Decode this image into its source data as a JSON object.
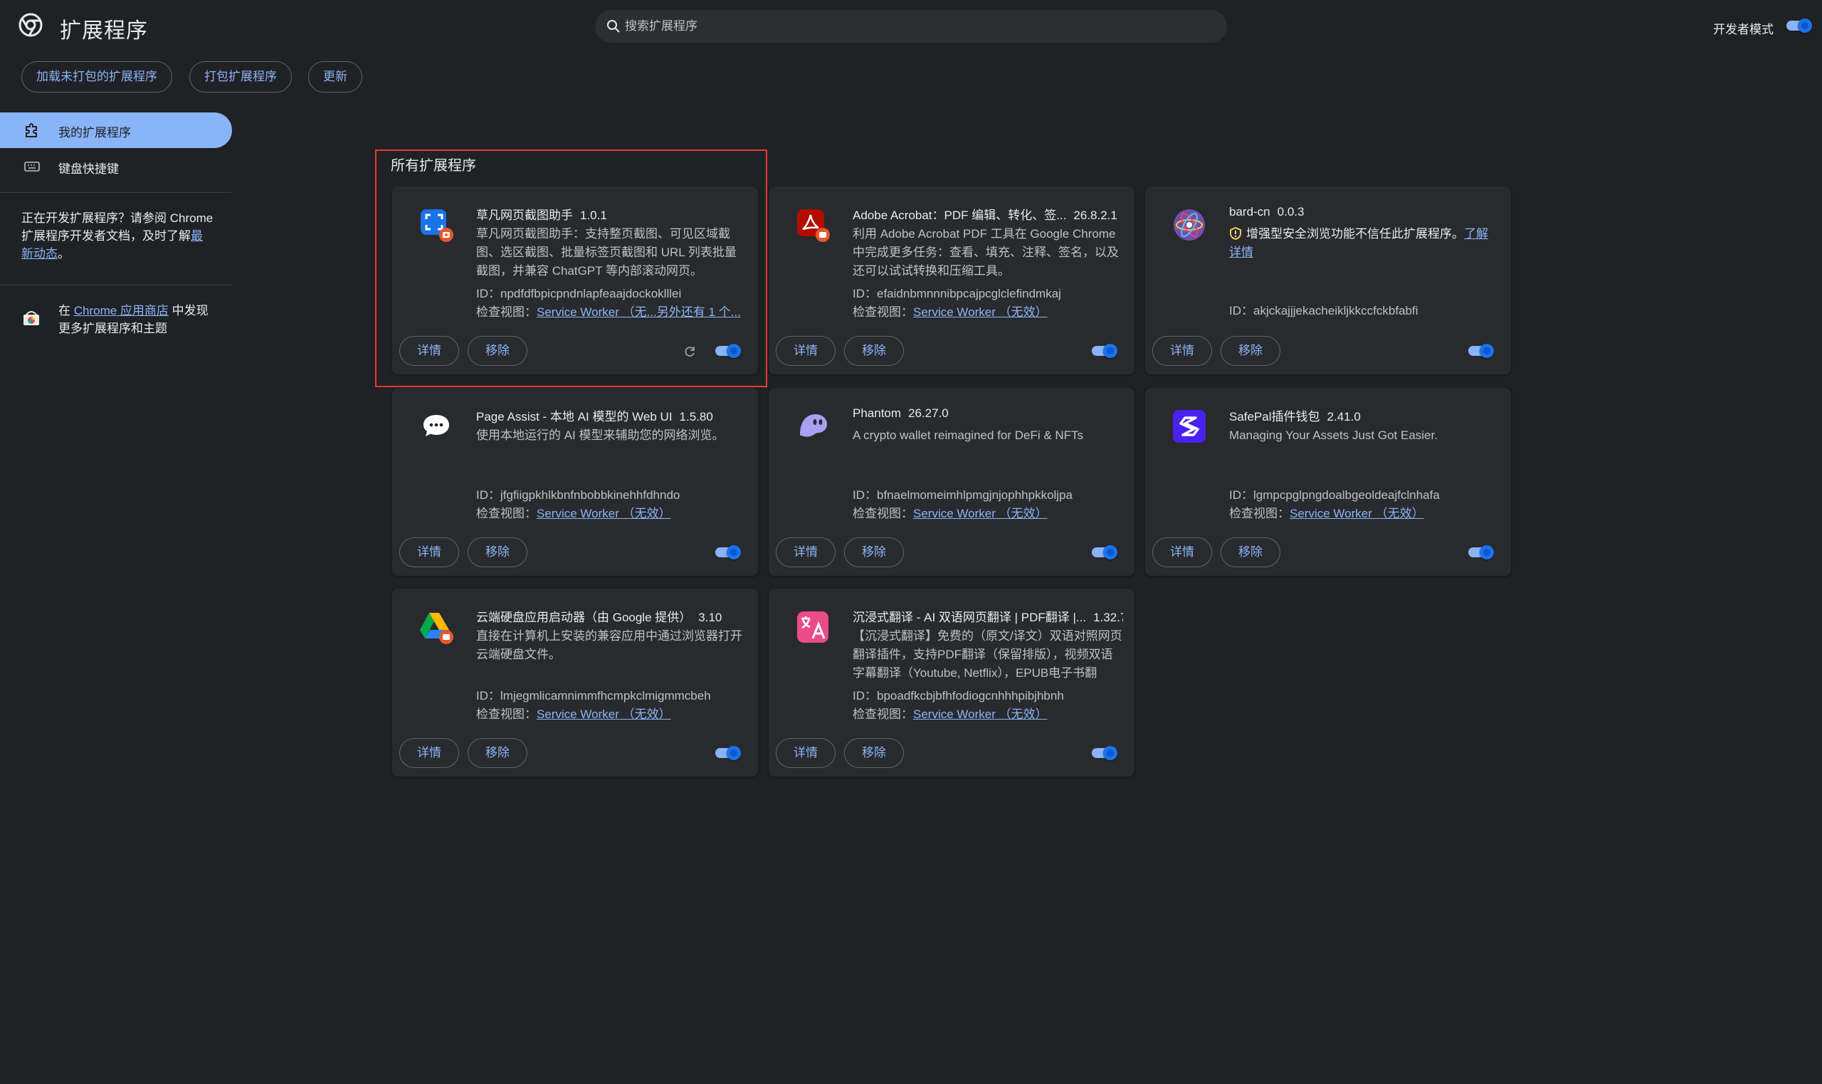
{
  "header": {
    "title": "扩展程序",
    "search_placeholder": "搜索扩展程序",
    "devmode_label": "开发者模式",
    "devmode_on": true
  },
  "toolbar": {
    "load_unpacked": "加载未打包的扩展程序",
    "pack": "打包扩展程序",
    "update": "更新"
  },
  "sidebar": {
    "items": [
      {
        "label": "我的扩展程序",
        "active": true
      },
      {
        "label": "键盘快捷键",
        "active": false
      }
    ],
    "dev_note_text": "正在开发扩展程序？请参阅 Chrome 扩展程序开发者文档，及时了解",
    "dev_note_link": "最新动态",
    "dev_note_end": "。",
    "store_prefix": "在 ",
    "store_link": "Chrome 应用商店",
    "store_suffix": " 中发现更多扩展程序和主题"
  },
  "main": {
    "section_title": "所有扩展程序",
    "details_label": "详情",
    "remove_label": "移除",
    "id_prefix": "ID：",
    "inspect_prefix": "检查视图：",
    "extensions": [
      {
        "name": "草凡网页截图助手",
        "version": "1.0.1",
        "description": "草凡网页截图助手：支持整页截图、可见区域截图、选区截图、批量标签页截图和 URL 列表批量截图，并兼容 ChatGPT 等内部滚动网页。",
        "id": "npdfdfbpicpndnlapfeaajdockoklllei",
        "inspect_link": "Service Worker （无...另外还有 1 个...",
        "icon": "screenshot-icon",
        "enabled": true,
        "reload": true
      },
      {
        "name": "Adobe Acrobat：PDF 编辑、转化、签...",
        "version": "26.8.2.1",
        "description": "利用 Adobe Acrobat PDF 工具在 Google Chrome 中完成更多任务：查看、填充、注释、签名，以及还可以试试转换和压缩工具。",
        "id": "efaidnbmnnnibpcajpcglclefindmkaj",
        "inspect_link": "Service Worker （无效）",
        "icon": "acrobat-icon",
        "enabled": true,
        "reload": false
      },
      {
        "name": "bard-cn",
        "version": "0.0.3",
        "warning": "增强型安全浏览功能不信任此扩展程序。",
        "warning_link": "了解详情",
        "id": "akjckajjjekacheikljkkccfckbfabfi",
        "icon": "atom-icon",
        "enabled": true,
        "reload": false
      },
      {
        "name": "Page Assist - 本地 AI 模型的 Web UI",
        "version": "1.5.80",
        "description": "使用本地运行的 AI 模型来辅助您的网络浏览。",
        "id": "jfgfiigpkhlkbnfnbobbkinehhfdhndo",
        "inspect_link": "Service Worker （无效）",
        "icon": "chat-bubble-icon",
        "enabled": true,
        "reload": false
      },
      {
        "name": "Phantom",
        "version": "26.27.0",
        "description": "A crypto wallet reimagined for DeFi & NFTs",
        "id": "bfnaelmomeimhlpmgjnjophhpkkoljpa",
        "inspect_link": "Service Worker （无效）",
        "icon": "phantom-ghost-icon",
        "enabled": true,
        "reload": false
      },
      {
        "name": "SafePal插件钱包",
        "version": "2.41.0",
        "description": "Managing Your Assets Just Got Easier.",
        "id": "lgmpcpglpngdoalbgeoldeajfclnhafa",
        "inspect_link": "Service Worker （无效）",
        "icon": "safepal-icon",
        "enabled": true,
        "reload": false
      },
      {
        "name": "云端硬盘应用启动器（由 Google 提供）",
        "version": "3.10",
        "description": "直接在计算机上安装的兼容应用中通过浏览器打开云端硬盘文件。",
        "id": "lmjegmlicamnimmfhcmpkclmigmmcbeh",
        "inspect_link": "Service Worker （无效）",
        "icon": "google-drive-icon",
        "enabled": true,
        "reload": false
      },
      {
        "name": "沉浸式翻译 - AI 双语网页翻译 | PDF翻译 |...",
        "version": "1.32.7",
        "description": "【沉浸式翻译】免费的（原文/译文）双语对照网页翻译插件，支持PDF翻译（保留排版），视频双语字幕翻译（Youtube, Netflix），EPUB电子书翻",
        "id": "bpoadfkcbjbfhfodiogcnhhhpibjhbnh",
        "inspect_link": "Service Worker （无效）",
        "icon": "translate-icon",
        "enabled": true,
        "reload": false
      }
    ]
  },
  "colors": {
    "accent": "#8ab4f8",
    "background": "#202124",
    "card": "#292a2d",
    "highlight": "#e53935"
  }
}
